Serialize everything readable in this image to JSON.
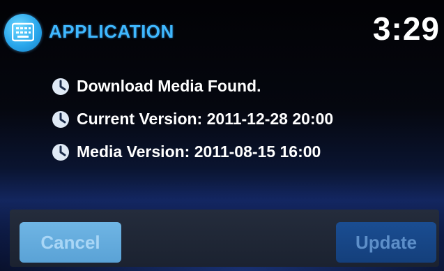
{
  "header": {
    "icon": "keyboard-icon",
    "title": "APPLICATION",
    "time": "3:29",
    "title_color": "#3fb8ff"
  },
  "info": {
    "items": [
      {
        "icon": "clock-icon",
        "text": "Download Media Found."
      },
      {
        "icon": "clock-icon",
        "text": "Current Version: 2011-12-28 20:00"
      },
      {
        "icon": "clock-icon",
        "text": "Media Version: 2011-08-15 16:00"
      }
    ]
  },
  "buttons": {
    "cancel_label": "Cancel",
    "update_label": "Update"
  }
}
